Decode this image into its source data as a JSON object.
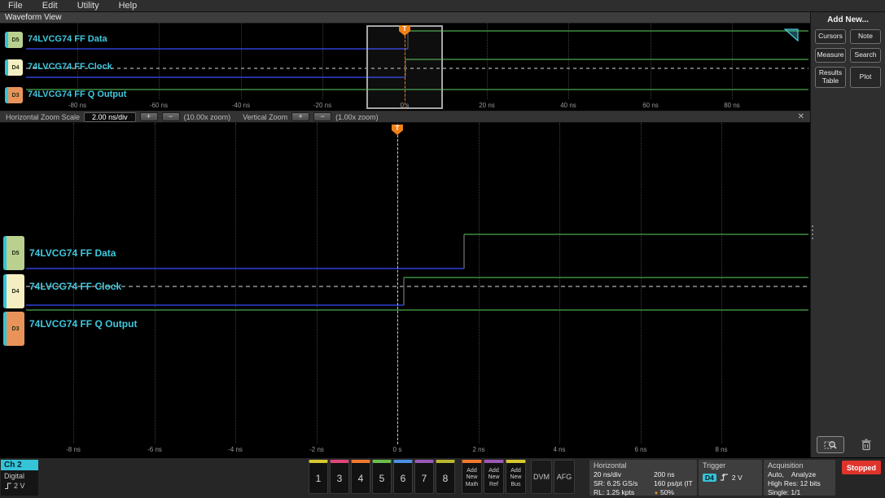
{
  "menu": {
    "items": [
      {
        "label": "File"
      },
      {
        "label": "Edit"
      },
      {
        "label": "Utility"
      },
      {
        "label": "Help"
      }
    ]
  },
  "waveform_view": {
    "title": "Waveform View"
  },
  "trigger_marker": "T",
  "signals": [
    {
      "badge": "D5",
      "label": "74LVCG74 FF Data",
      "badge_color": "#b9d08f"
    },
    {
      "badge": "D4",
      "label": "74LVCG74 FF Clock",
      "badge_color": "#f4eec2"
    },
    {
      "badge": "D3",
      "label": "74LVCG74 FF Q Output",
      "badge_color": "#e9935a"
    }
  ],
  "waveform_data": {
    "type": "digital-timing",
    "signals": [
      {
        "id": "D5",
        "name": "74LVCG74 FF Data",
        "behavior": "low until +1.65 ns, then high"
      },
      {
        "id": "D4",
        "name": "74LVCG74 FF Clock",
        "behavior": "low until +0.15 ns, then high; dashed baseline (trigger source)"
      },
      {
        "id": "D3",
        "name": "74LVCG74 FF Q Output",
        "behavior": "high throughout"
      }
    ],
    "overview_span_ns": [
      -90,
      90
    ],
    "zoom_span_ns": [
      -9,
      9
    ]
  },
  "overview": {
    "time_labels": [
      "-80 ns",
      "-60 ns",
      "-40 ns",
      "-20 ns",
      "0 s",
      "20 ns",
      "40 ns",
      "60 ns",
      "80 ns"
    ]
  },
  "zoom_controls": {
    "h_scale_label": "Horizontal Zoom Scale",
    "h_scale_value": "2.00 ns/div",
    "plus_label": "+",
    "minus_label": "−",
    "h_zoom_readout": "(10.00x zoom)",
    "v_label": "Vertical Zoom",
    "v_zoom_readout": "(1.00x zoom)",
    "close_label": "✕"
  },
  "zoomed_view": {
    "time_labels": [
      "-8 ns",
      "-6 ns",
      "-4 ns",
      "-2 ns",
      "0 s",
      "2 ns",
      "4 ns",
      "6 ns",
      "8 ns"
    ]
  },
  "add_new_panel": {
    "title": "Add New...",
    "buttons": [
      {
        "label": "Cursors"
      },
      {
        "label": "Note"
      },
      {
        "label": "Measure"
      },
      {
        "label": "Search"
      },
      {
        "label": "Results Table"
      },
      {
        "label": "Plot"
      }
    ]
  },
  "bottom_bar": {
    "active_channel": {
      "name": "Ch 2",
      "type": "Digital",
      "threshold": "2 V"
    },
    "channel_buttons": [
      {
        "label": "1",
        "color": "#d8c832"
      },
      {
        "label": "3",
        "color": "#e0457b"
      },
      {
        "label": "4",
        "color": "#f07830"
      },
      {
        "label": "5",
        "color": "#6abf4b"
      },
      {
        "label": "6",
        "color": "#4a90e2"
      },
      {
        "label": "7",
        "color": "#9b59b6"
      },
      {
        "label": "8",
        "color": "#b8b830"
      }
    ],
    "add_buttons": [
      {
        "label": "Add New Math",
        "color": "#f07830"
      },
      {
        "label": "Add New Ref",
        "color": "#9b59b6"
      },
      {
        "label": "Add New Bus",
        "color": "#d8c832"
      }
    ],
    "dvm_label": "DVM",
    "afg_label": "AFG",
    "horizontal": {
      "title": "Horizontal",
      "col1": [
        "20 ns/div",
        "SR: 6.25 GS/s",
        "RL: 1.25 kpts"
      ],
      "col2": [
        "200 ns",
        "160 ps/pt (IT",
        "50%"
      ]
    },
    "trigger": {
      "title": "Trigger",
      "source": "D4",
      "level": "2 V"
    },
    "acquisition": {
      "title": "Acquisition",
      "rows": [
        "Auto,    Analyze",
        "High Res: 12 bits",
        "Single: 1/1"
      ]
    },
    "status": "Stopped"
  }
}
